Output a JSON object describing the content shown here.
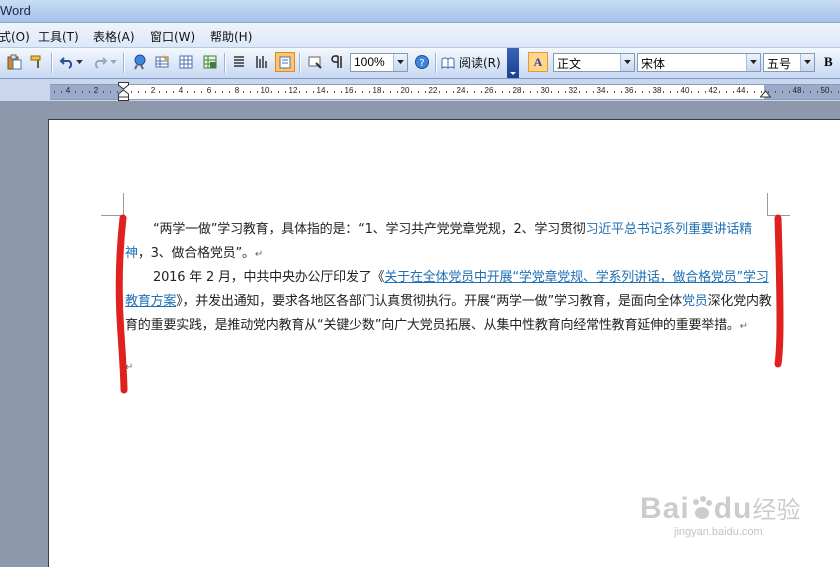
{
  "window": {
    "title": "Word"
  },
  "menu": {
    "items": [
      {
        "label": "式(O)"
      },
      {
        "label": "工具(T)"
      },
      {
        "label": "表格(A)"
      },
      {
        "label": "窗口(W)"
      },
      {
        "label": "帮助(H)"
      }
    ]
  },
  "toolbar": {
    "zoom": "100%",
    "read_label": "阅读(R)",
    "style": "正文",
    "font": "宋体",
    "size": "五号",
    "bold_label": "B",
    "style_icon_label": "A"
  },
  "ruler": {
    "labels": [
      "4",
      "2",
      "2",
      "4",
      "6",
      "8",
      "10",
      "12",
      "14",
      "16",
      "18",
      "20",
      "22",
      "24",
      "26",
      "28",
      "30",
      "32",
      "34",
      "36",
      "38",
      "40",
      "42",
      "44",
      "48",
      "50"
    ]
  },
  "document": {
    "p1": {
      "text_a": "“两学一做”学习教育，具体指的是：“1、学习共产党党章党规，2、学习贯彻",
      "link_a": "习近平总书记系列重要讲话精神",
      "text_b": "，3、做合格党员”。"
    },
    "p2": {
      "text_a": "2016 年 2 月，中共中央办公厅印发了《",
      "hyper_a": "关于在全体党员中开展“学党章党规、学系列讲话，做合格党员”学习教育方案",
      "text_b": "》，并发出通知，要求各地区各部门认真贯彻执行。开展“两学一做”学习教育，是面向全体",
      "link_b": "党员",
      "text_c": "深化党内教育的重要实践，是推动党内教育从“关键少数”向广大党员拓展、从集中性教育向经常性教育延伸的重要举措。"
    },
    "paragraph_mark": "↵"
  },
  "watermark": {
    "brand": "Bai",
    "brand2": "du",
    "cn": "经验",
    "url": "jingyan.baidu.com"
  },
  "colors": {
    "annotation": "#e0211f",
    "link": "#1f6fb3"
  }
}
